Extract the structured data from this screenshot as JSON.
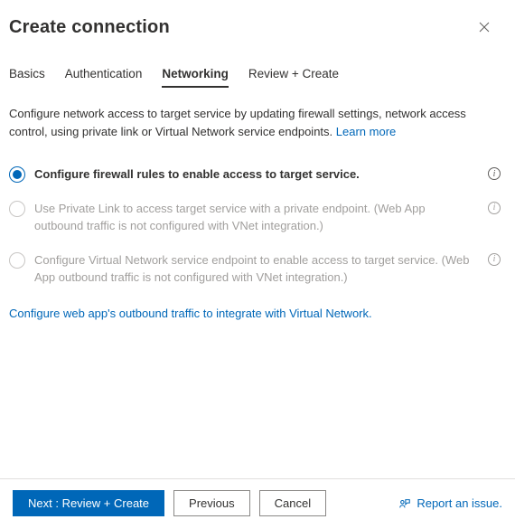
{
  "header": {
    "title": "Create connection"
  },
  "tabs": {
    "items": [
      {
        "label": "Basics"
      },
      {
        "label": "Authentication"
      },
      {
        "label": "Networking"
      },
      {
        "label": "Review + Create"
      }
    ]
  },
  "content": {
    "description": "Configure network access to target service by updating firewall settings, network access control, using private link or Virtual Network service endpoints.",
    "learn_more": "Learn more",
    "options": [
      {
        "label": "Configure firewall rules to enable access to target service."
      },
      {
        "label": "Use Private Link to access target service with a private endpoint. (Web App outbound traffic is not configured with VNet integration.)"
      },
      {
        "label": "Configure Virtual Network service endpoint to enable access to target service. (Web App outbound traffic is not configured with VNet integration.)"
      }
    ],
    "configure_link": "Configure web app's outbound traffic to integrate with Virtual Network."
  },
  "footer": {
    "next": "Next : Review + Create",
    "previous": "Previous",
    "cancel": "Cancel",
    "report": "Report an issue."
  }
}
